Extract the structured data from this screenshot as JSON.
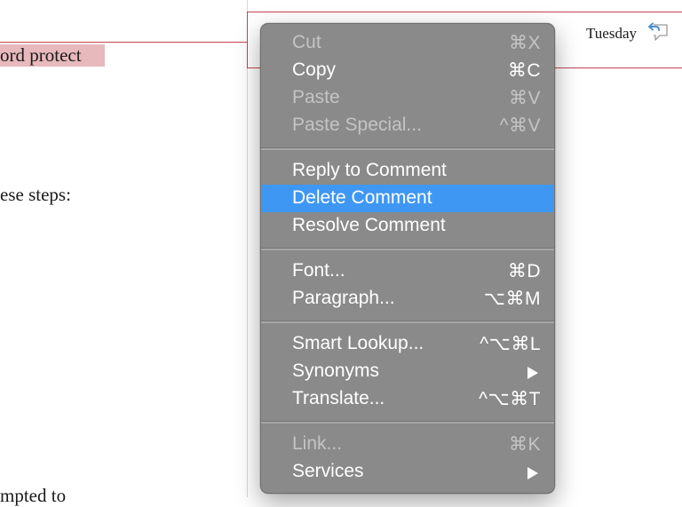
{
  "document": {
    "line1": "ord protect",
    "line2": "ese steps:",
    "line3": "mpted to"
  },
  "comment": {
    "date": "Tuesday"
  },
  "context_menu": {
    "groups": [
      [
        {
          "label": "Cut",
          "shortcut": "⌘X",
          "disabled": true
        },
        {
          "label": "Copy",
          "shortcut": "⌘C",
          "disabled": false
        },
        {
          "label": "Paste",
          "shortcut": "⌘V",
          "disabled": true
        },
        {
          "label": "Paste Special...",
          "shortcut": "^⌘V",
          "disabled": true
        }
      ],
      [
        {
          "label": "Reply to Comment",
          "shortcut": "",
          "disabled": false
        },
        {
          "label": "Delete Comment",
          "shortcut": "",
          "disabled": false,
          "highlighted": true
        },
        {
          "label": "Resolve Comment",
          "shortcut": "",
          "disabled": false
        }
      ],
      [
        {
          "label": "Font...",
          "shortcut": "⌘D",
          "disabled": false
        },
        {
          "label": "Paragraph...",
          "shortcut": "⌥⌘M",
          "disabled": false
        }
      ],
      [
        {
          "label": "Smart Lookup...",
          "shortcut": "^⌥⌘L",
          "disabled": false
        },
        {
          "label": "Synonyms",
          "shortcut": "",
          "disabled": false,
          "submenu": true
        },
        {
          "label": "Translate...",
          "shortcut": "^⌥⌘T",
          "disabled": false
        }
      ],
      [
        {
          "label": "Link...",
          "shortcut": "⌘K",
          "disabled": true
        },
        {
          "label": "Services",
          "shortcut": "",
          "disabled": false,
          "submenu": true
        }
      ]
    ]
  },
  "colors": {
    "menu_background": "#8a8a8a",
    "menu_highlight": "#3f97f4",
    "comment_border": "#c0474d",
    "text_highlight": "#e7b9bc"
  },
  "icons": {
    "reply": "reply-comment-icon",
    "submenu": "chevron-right-icon"
  }
}
